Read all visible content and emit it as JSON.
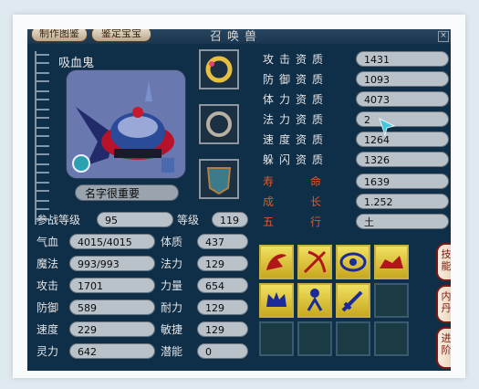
{
  "top_buttons": {
    "left": "制作图鉴",
    "right": "鉴定宝宝"
  },
  "window_title": "召唤兽",
  "pet": {
    "name": "吸血鬼",
    "nickname": "名字很重要"
  },
  "equipment_slots": [
    "ring-gold-icon",
    "ring-silver-icon",
    "armor-icon"
  ],
  "left_stats": {
    "battle_level_label": "参战等级",
    "battle_level": "95",
    "level_label": "等级",
    "level": "119",
    "hp_label": "气血",
    "hp": "4015/4015",
    "constitution_label": "体质",
    "constitution": "437",
    "mp_label": "魔法",
    "mp": "993/993",
    "magic_label": "法力",
    "magic": "129",
    "attack_label": "攻击",
    "attack": "1701",
    "strength_label": "力量",
    "strength": "654",
    "defense_label": "防御",
    "defense": "589",
    "endurance_label": "耐力",
    "endurance": "129",
    "speed_label": "速度",
    "speed": "229",
    "agility_label": "敏捷",
    "agility": "129",
    "spirit_label": "灵力",
    "spirit": "642",
    "potential_label": "潜能",
    "potential": "0"
  },
  "aptitudes": [
    {
      "label": "攻击资质",
      "value": "1431"
    },
    {
      "label": "防御资质",
      "value": "1093"
    },
    {
      "label": "体力资质",
      "value": "4073"
    },
    {
      "label": "法力资质",
      "value": "2"
    },
    {
      "label": "速度资质",
      "value": "1264"
    },
    {
      "label": "躲闪资质",
      "value": "1326"
    }
  ],
  "extra": [
    {
      "label": "寿命",
      "value": "1639"
    },
    {
      "label": "成长",
      "value": "1.252"
    },
    {
      "label": "五行",
      "value": "土"
    }
  ],
  "skills": [
    "skill-claw-icon",
    "skill-bow-icon",
    "skill-eye-icon",
    "skill-beast-icon",
    "skill-crown-icon",
    "skill-figure-icon",
    "skill-sword-icon"
  ],
  "side_tabs": [
    "技能",
    "内丹",
    "进阶"
  ],
  "colors": {
    "window_bg": "#0f2e48",
    "field_bg": "#b9c1c9",
    "skill_gold": "#e8d040",
    "tab_red": "#7a1a14",
    "label_red": "#e05a2a"
  }
}
